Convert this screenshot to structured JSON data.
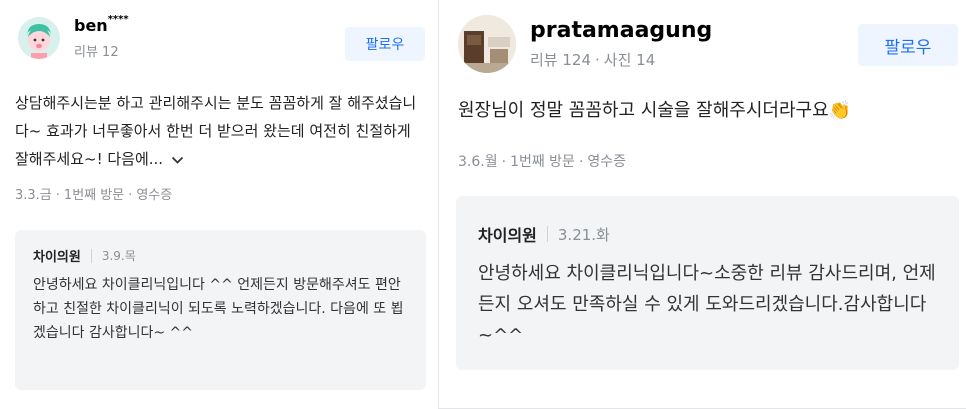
{
  "reviews": [
    {
      "user": {
        "name": "ben",
        "name_suffix": "****",
        "meta": "리뷰 12"
      },
      "follow_label": "팔로우",
      "text": "상담해주시는분 하고 관리해주시는 분도 꼼꼼하게 잘 해주셨습니다~ 효과가 너무좋아서 한번 더 받으러 왔는데 여전히 친절하게 잘해주세요~! 다음에...",
      "visit": {
        "date": "3.3.금",
        "count": "1번째 방문",
        "receipt": "영수증"
      },
      "reply": {
        "name": "차이의원",
        "date": "3.9.목",
        "text": "안녕하세요 차이클리닉입니다 ^^ 언제든지 방문해주셔도 편안하고 친절한 차이클리닉이 되도록 노력하겠습니다. 다음에 또 뵙겠습니다 감사합니다~ ^^"
      }
    },
    {
      "user": {
        "name": "pratamaagung",
        "reviews": "리뷰 124",
        "photos": "사진 14"
      },
      "follow_label": "팔로우",
      "text": "원장님이 정말 꼼꼼하고 시술을 잘해주시더라구요👏",
      "visit": {
        "date": "3.6.월",
        "count": "1번째 방문",
        "receipt": "영수증"
      },
      "reply": {
        "name": "차이의원",
        "date": "3.21.화",
        "text": "안녕하세요 차이클리닉입니다~소중한 리뷰 감사드리며, 언제든지 오셔도 만족하실 수 있게 도와드리겠습니다.감사합니다~^^"
      }
    }
  ],
  "icons": {
    "left_avatar": "cartoon-avatar-icon",
    "right_avatar": "photo-avatar-icon",
    "more": "chevron-down-icon"
  },
  "colors": {
    "follow_bg": "#eef5ff",
    "follow_text": "#1f6ff5",
    "reply_bg": "#f3f4f6",
    "muted": "#8a8f95"
  }
}
